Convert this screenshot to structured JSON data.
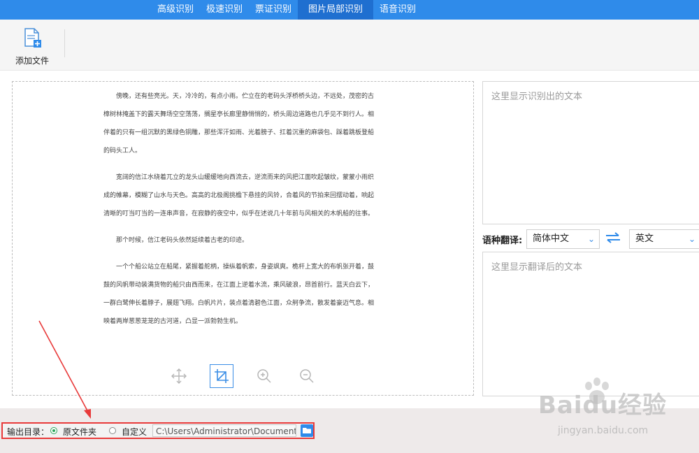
{
  "nav": {
    "tabs": [
      {
        "label": "高级识别"
      },
      {
        "label": "极速识别"
      },
      {
        "label": "票证识别"
      },
      {
        "label": "图片局部识别"
      },
      {
        "label": "语音识别"
      }
    ],
    "active_index": 3
  },
  "toolbar": {
    "add_file_label": "添加文件"
  },
  "document": {
    "paragraphs": [
      "傍晚，还有些亮光。天，冷冷的，有点小雨。伫立在的老码头浮桥桥头边，不远处，茂密的古樟树林掩盖下的露天舞场空空荡荡，搁星亭长廊里静悄悄的，桥头周边道路也几乎见不到行人。相伴着的只有一组沉默的黑绿色铜雕，那些浑汗如雨、光着膀子、扛着沉重的麻袋包、踩着跳板登船的码头工人。",
      "宽阔的信江水绕着兀立的龙头山缓缓地向西流去，逆流而来的风把江面吹起皱纹，蒙蒙小雨织成的帷幕，模糊了山水与天色。高高的北极阁挑檐下悬挂的风铃，合着风的节拍来回摆动着，响起清晰的叮当叮当的一连串声音，在寂静的夜空中，似乎在述说几十年前与风相关的木帆船的往事。",
      "那个时候，信江老码头依然延续着古老的印迹。",
      "一个个船公站立在船尾，紧握着舵柄，操纵着帆索，身姿飒爽。桅杆上宽大的布帆张开着，鼓鼓的风帆带动装满货物的船只由西而来，在江面上逆着水流，乘风破浪，昂首前行。蓝天白云下，一群白鹭伸长着脖子，展翅飞翔。白帆片片，装点着清碧色江面，众舸争流，散发着豪迈气息。相映着两岸葱葱茏茏的古河道，凸显一派勃勃生机。"
    ]
  },
  "tools": [
    {
      "icon": "move-icon"
    },
    {
      "icon": "crop-icon",
      "selected": true
    },
    {
      "icon": "zoom-in-icon"
    },
    {
      "icon": "zoom-out-icon"
    }
  ],
  "ocr": {
    "placeholder": "这里显示识别出的文本"
  },
  "translate": {
    "label": "语种翻译:",
    "source_lang": "简体中文",
    "target_lang": "英文",
    "placeholder": "这里显示翻译后的文本"
  },
  "output": {
    "label": "输出目录：",
    "option_original": "原文件夹",
    "option_custom": "自定义",
    "selected": "original",
    "path": "C:\\Users\\Administrator\\Documents"
  },
  "watermark": {
    "text": "Baidu经验",
    "sub": "jingyan.baidu.com"
  },
  "colors": {
    "nav_bg": "#2f8bea",
    "accent": "#3a8ee6",
    "highlight_border": "#e83a3a",
    "radio_on": "#2aa65a"
  }
}
